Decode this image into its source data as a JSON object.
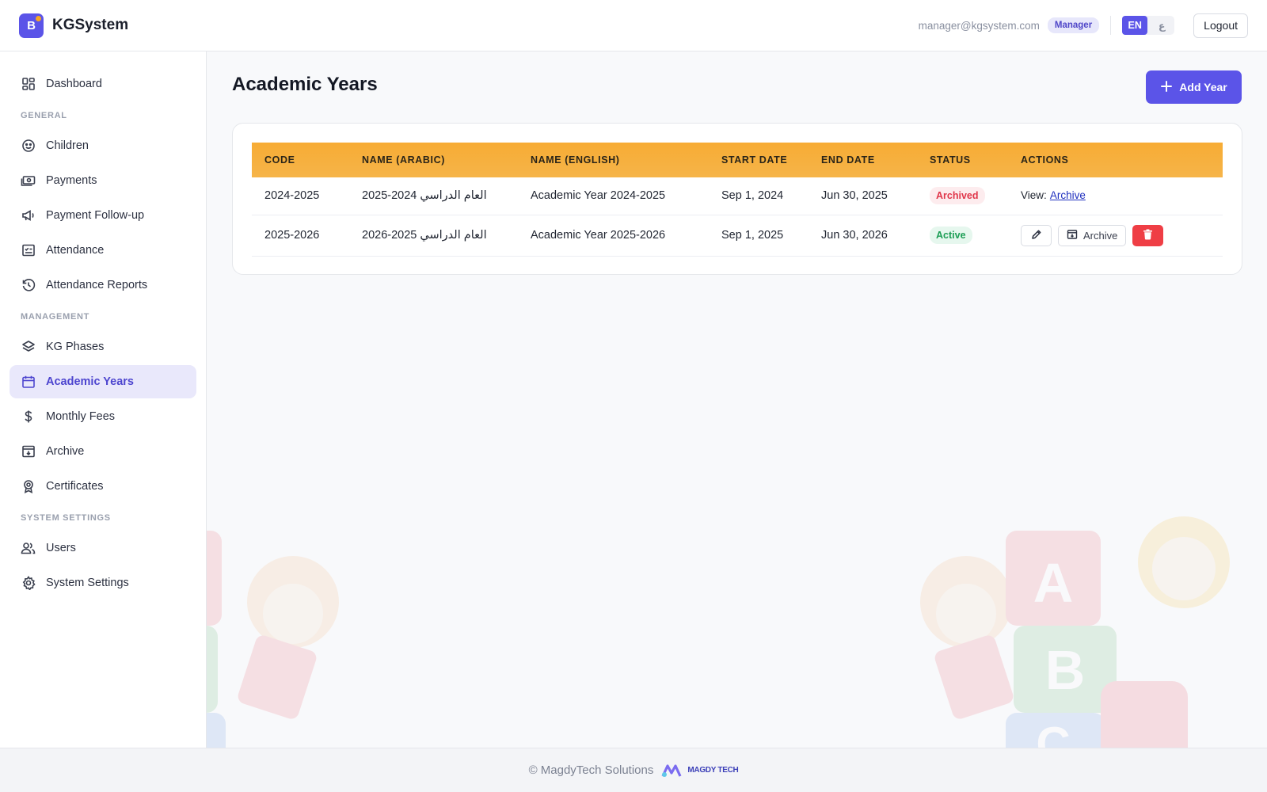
{
  "header": {
    "brand_initial": "B",
    "brand_name": "KGSystem",
    "user_email": "manager@kgsystem.com",
    "role": "Manager",
    "lang_en": "EN",
    "lang_ar": "ع",
    "logout": "Logout"
  },
  "sidebar": {
    "dashboard": "Dashboard",
    "section_general": "GENERAL",
    "children": "Children",
    "payments": "Payments",
    "payment_followup": "Payment Follow-up",
    "attendance": "Attendance",
    "attendance_reports": "Attendance Reports",
    "section_management": "MANAGEMENT",
    "kg_phases": "KG Phases",
    "academic_years": "Academic Years",
    "monthly_fees": "Monthly Fees",
    "archive": "Archive",
    "certificates": "Certificates",
    "section_system": "SYSTEM SETTINGS",
    "users": "Users",
    "system_settings": "System Settings"
  },
  "main": {
    "title": "Academic Years",
    "add_button": "Add Year",
    "table": {
      "headers": [
        "CODE",
        "NAME (ARABIC)",
        "NAME (ENGLISH)",
        "START DATE",
        "END DATE",
        "STATUS",
        "ACTIONS"
      ],
      "rows": [
        {
          "code": "2024-2025",
          "name_ar": "العام الدراسي 2024-2025",
          "name_en": "Academic Year 2024-2025",
          "start": "Sep 1, 2024",
          "end": "Jun 30, 2025",
          "status": "Archived",
          "view_label": "View:",
          "view_link": "Archive"
        },
        {
          "code": "2025-2026",
          "name_ar": "العام الدراسي 2025-2026",
          "name_en": "Academic Year 2025-2026",
          "start": "Sep 1, 2025",
          "end": "Jun 30, 2026",
          "status": "Active",
          "archive_button": "Archive"
        }
      ]
    }
  },
  "footer": {
    "copyright": "© MagdyTech Solutions",
    "logo_text": "MAGDY TECH"
  },
  "colors": {
    "accent": "#5b54e8",
    "table_header": "#f7ac34",
    "archived": "#e0364a",
    "active": "#1c9e55",
    "danger": "#ef3e45"
  }
}
